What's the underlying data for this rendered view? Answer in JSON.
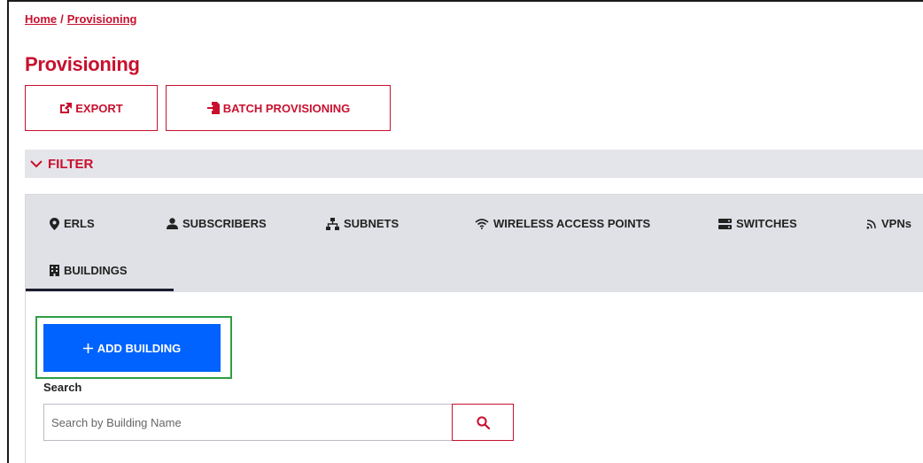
{
  "breadcrumb": {
    "home": "Home",
    "separator": "/",
    "current": "Provisioning"
  },
  "page": {
    "title": "Provisioning"
  },
  "toolbar": {
    "export_label": "EXPORT",
    "batch_label": "BATCH PROVISIONING"
  },
  "filter": {
    "label": "FILTER",
    "expanded": false
  },
  "tabs": [
    {
      "label": "ERLS",
      "icon": "map-pin-icon"
    },
    {
      "label": "SUBSCRIBERS",
      "icon": "user-icon"
    },
    {
      "label": "SUBNETS",
      "icon": "network-icon"
    },
    {
      "label": "WIRELESS ACCESS POINTS",
      "icon": "wifi-icon"
    },
    {
      "label": "SWITCHES",
      "icon": "server-icon"
    },
    {
      "label": "VPNs",
      "icon": "rss-icon"
    },
    {
      "label": "BUILDINGS",
      "icon": "building-icon",
      "active": true
    }
  ],
  "actions": {
    "add_building_label": "ADD BUILDING"
  },
  "search": {
    "label": "Search",
    "placeholder": "Search by Building Name",
    "value": ""
  },
  "colors": {
    "accent": "#c8102e",
    "primary": "#0062ff",
    "highlight": "#2f9e44",
    "tab_bg": "#e0e1e6"
  }
}
